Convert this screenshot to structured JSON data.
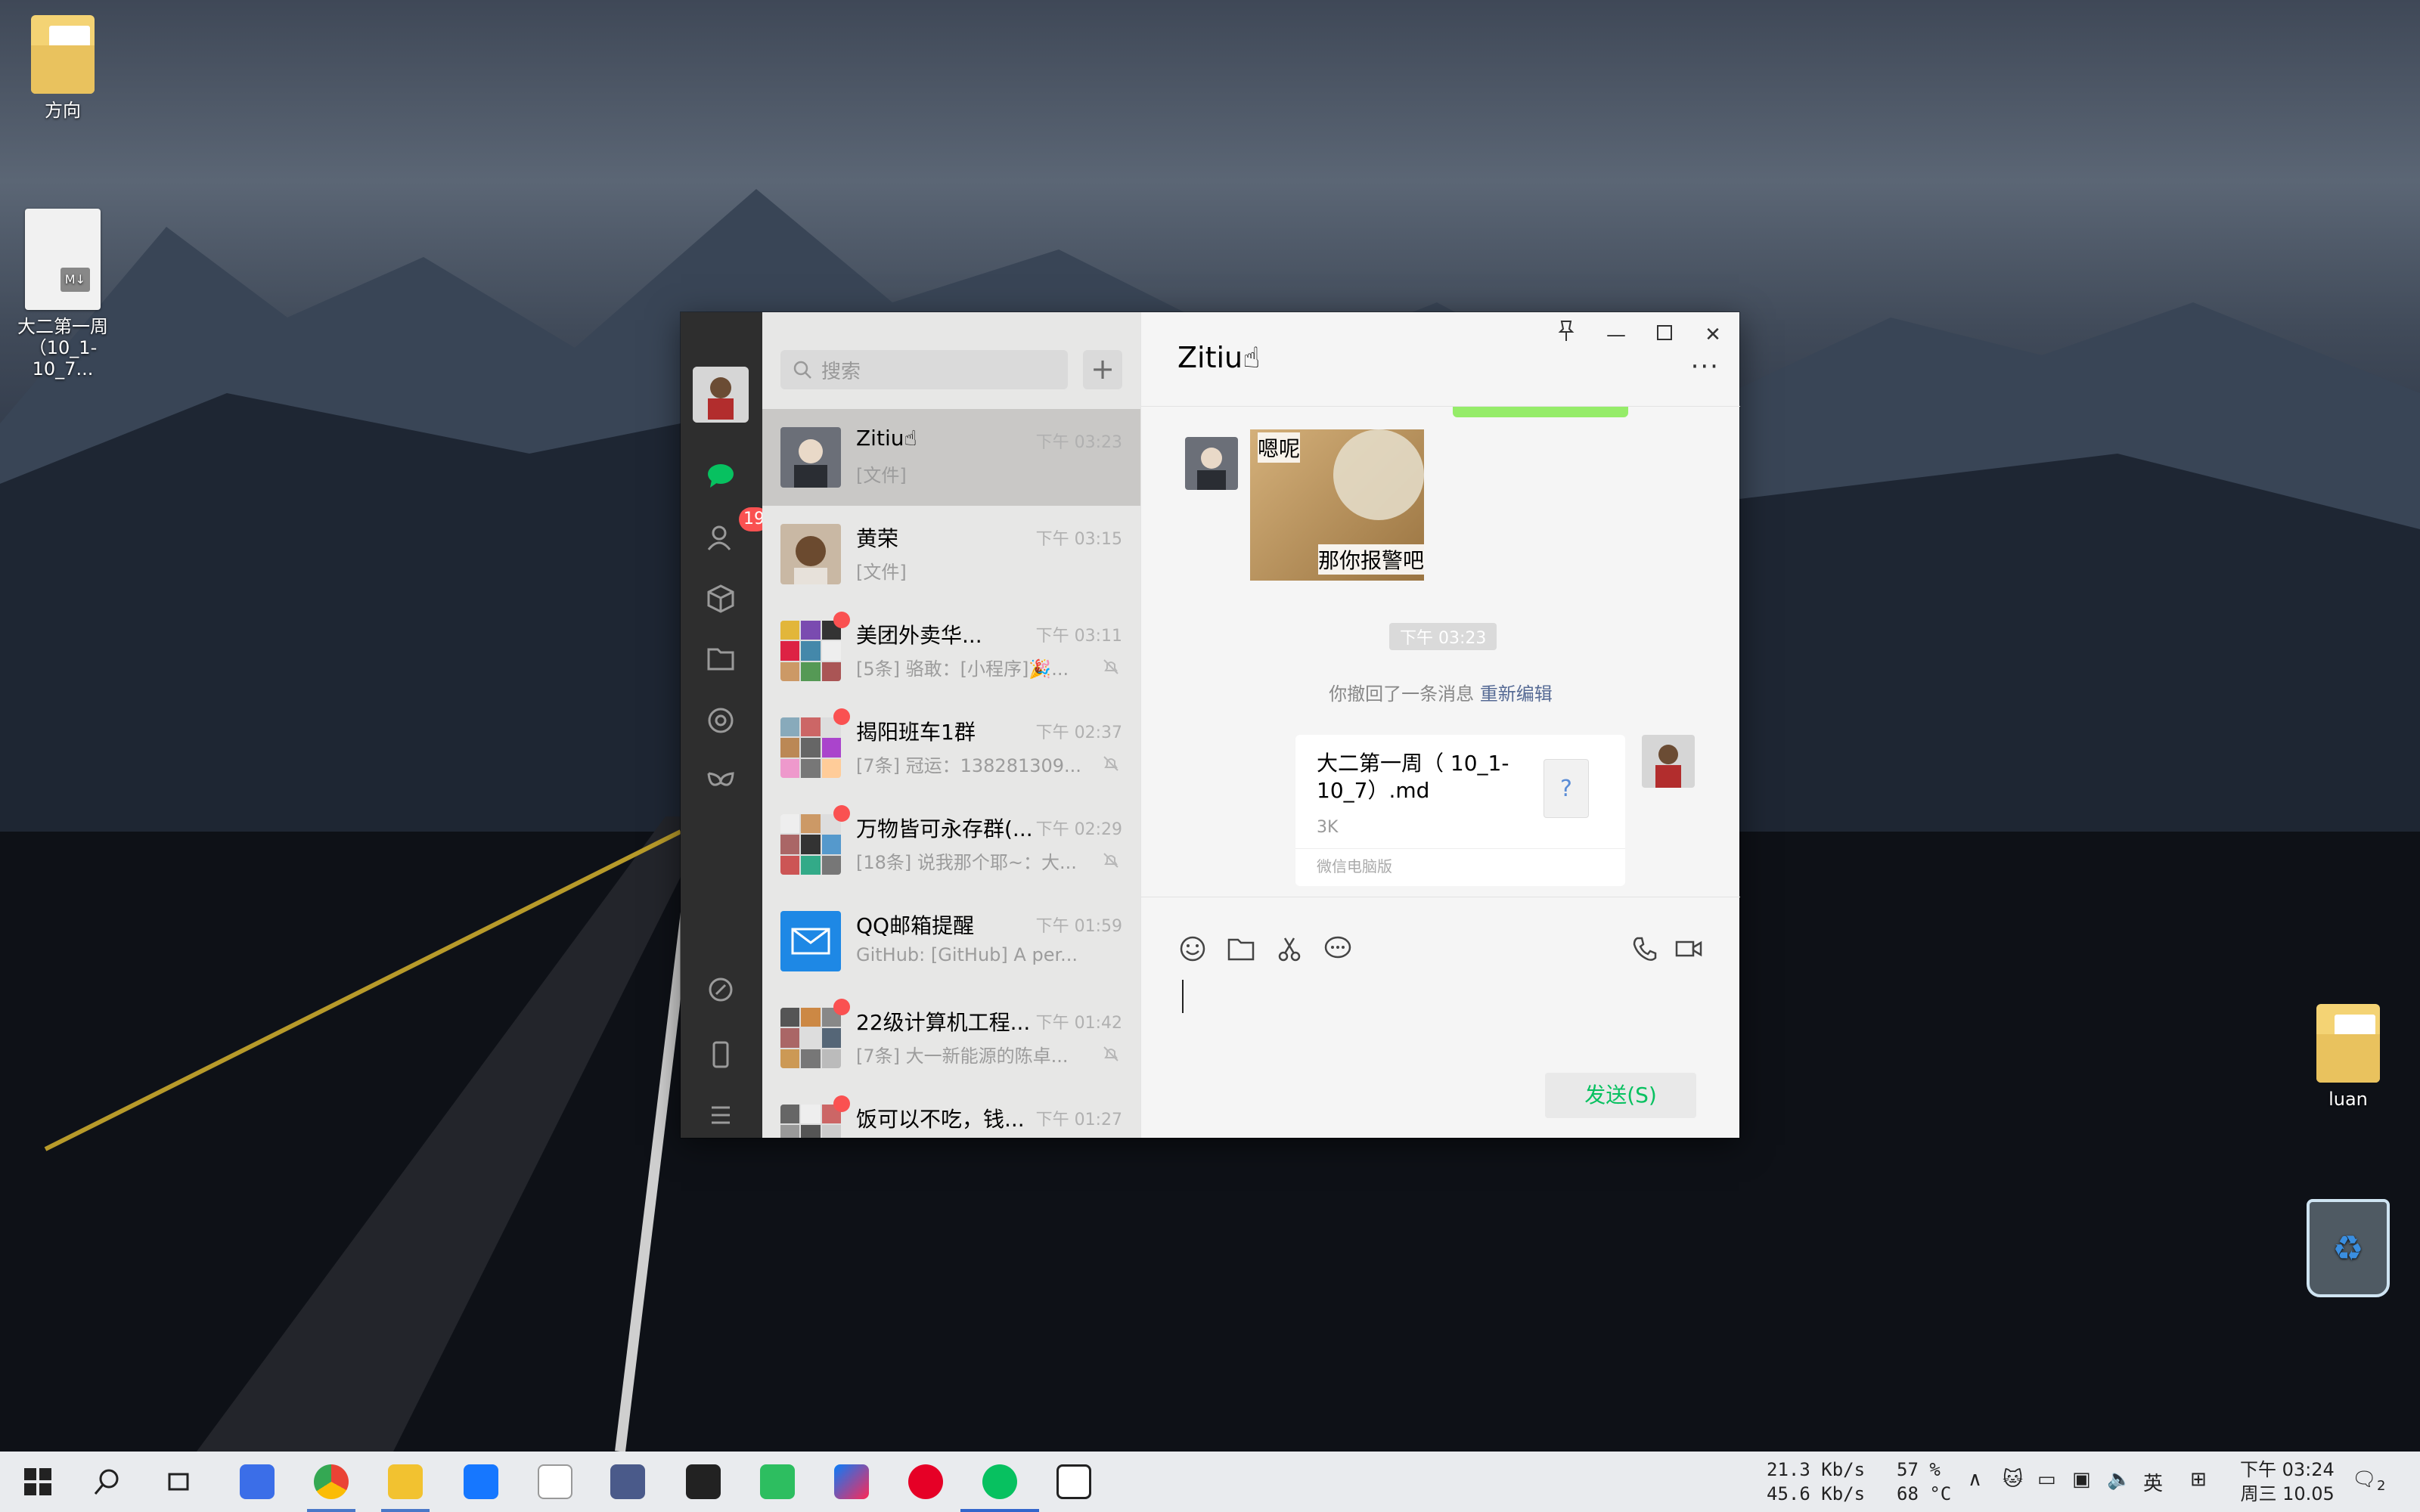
{
  "desktop": {
    "icons": [
      {
        "label": "方向"
      },
      {
        "label": "大二第一周（10_1-10_7..."
      },
      {
        "label": "luan"
      }
    ]
  },
  "wechat": {
    "nav": {
      "contacts_badge": "19"
    },
    "search": {
      "placeholder": "搜索"
    },
    "add_label": "+",
    "conversations": [
      {
        "name": "Zitiu☝",
        "time": "下午 03:23",
        "msg": "[文件]"
      },
      {
        "name": "黄荣",
        "time": "下午 03:15",
        "msg": "[文件]"
      },
      {
        "name": "美团外卖华...",
        "time": "下午 03:11",
        "msg": "[5条] 骆敢：[小程序]🎉..."
      },
      {
        "name": "揭阳班车1群",
        "time": "下午 02:37",
        "msg": "[7条] 冠运：138281309..."
      },
      {
        "name": "万物皆可永存群(...",
        "time": "下午 02:29",
        "msg": "[18条] 说我那个耶~：大..."
      },
      {
        "name": "QQ邮箱提醒",
        "time": "下午 01:59",
        "msg": "GitHub: [GitHub] A per..."
      },
      {
        "name": "22级计算机工程...",
        "time": "下午 01:42",
        "msg": "[7条] 大一新能源的陈卓..."
      },
      {
        "name": "饭可以不吃，钱...",
        "time": "下午 01:27",
        "msg": ""
      }
    ],
    "chat": {
      "title": "Zitiu☝",
      "sticker_top": "嗯呢",
      "sticker_bottom": "那你报警吧",
      "time_divider": "下午 03:23",
      "recall_text": "你撤回了一条消息",
      "recall_link": "重新编辑",
      "file": {
        "name": "大二第一周（ 10_1-10_7）.md",
        "size": "3K",
        "source": "微信电脑版",
        "icon_glyph": "?"
      },
      "send_label": "发送(S)"
    },
    "colors": {
      "accent": "#07c160",
      "badge": "#fa5151",
      "sidebar": "#2e2e2e"
    }
  },
  "taskbar": {
    "net_up": "21.3 Kb/s",
    "net_down": "45.6 Kb/s",
    "cpu": "57 %",
    "temp": "68 °C",
    "ime": "英",
    "time": "下午 03:24",
    "date": "周三 10.05",
    "notif_count": "2",
    "apps": [
      "start-icon",
      "search-icon",
      "task-view-icon",
      "buds-icon",
      "chrome-icon",
      "file-explorer-icon",
      "star-app-icon",
      "notes-icon",
      "ghost-icon",
      "7zip-icon",
      "evernote-icon",
      "jetbrains-icon",
      "netease-music-icon",
      "wechat-icon",
      "typora-icon"
    ]
  }
}
